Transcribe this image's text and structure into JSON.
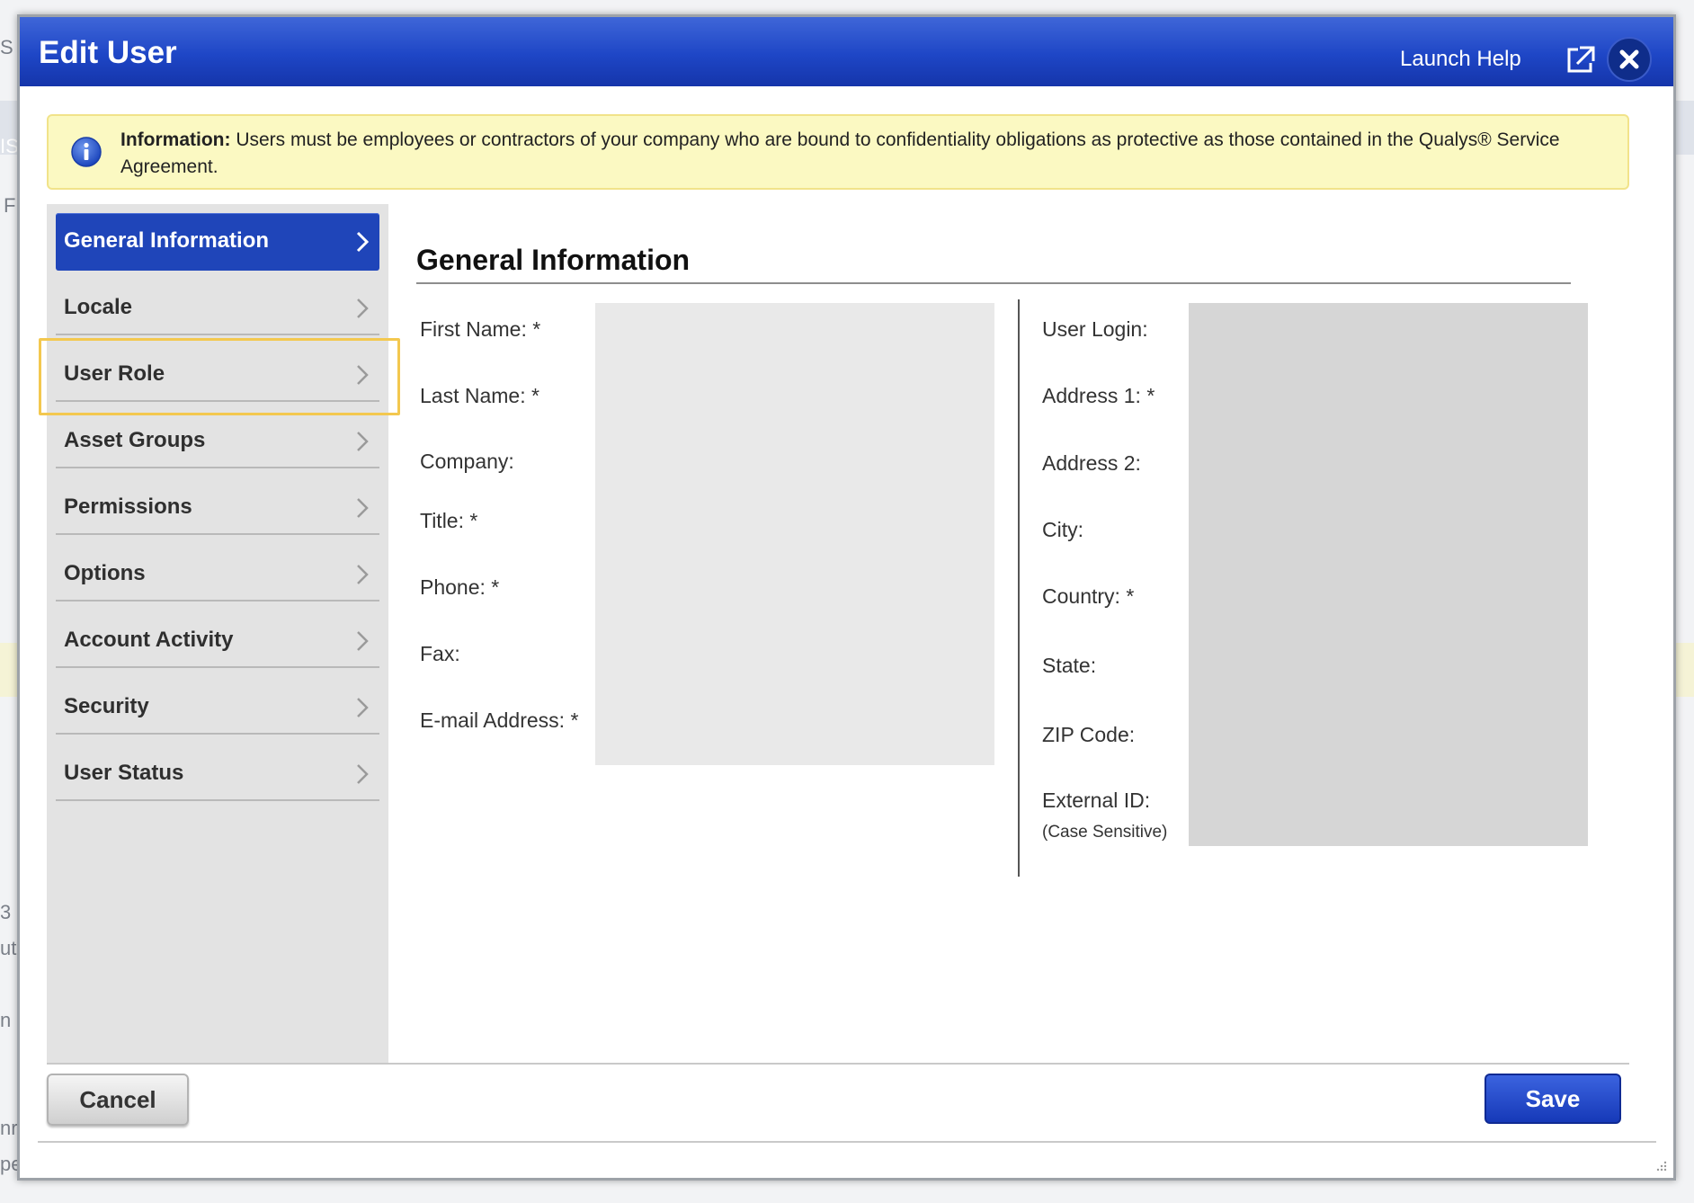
{
  "background": {
    "fragments": [
      "S",
      "IS",
      "F",
      "3",
      "ut",
      "n",
      "nr",
      "pe"
    ]
  },
  "dialog": {
    "title": "Edit User",
    "launch_help": "Launch Help",
    "popout_icon": "external-link-icon",
    "close_icon": "close-icon",
    "accent_color": "#1e46c6"
  },
  "info": {
    "icon": "info-icon",
    "heading": "Information:",
    "text": "Users must be employees or contractors of your company who are bound to confidentiality obligations as protective as those contained in the Qualys® Service Agreement."
  },
  "sidebar": {
    "items": [
      {
        "label": "General Information",
        "active": true
      },
      {
        "label": "Locale",
        "active": false
      },
      {
        "label": "User Role",
        "active": false
      },
      {
        "label": "Asset Groups",
        "active": false
      },
      {
        "label": "Permissions",
        "active": false
      },
      {
        "label": "Options",
        "active": false
      },
      {
        "label": "Account Activity",
        "active": false
      },
      {
        "label": "Security",
        "active": false
      },
      {
        "label": "User Status",
        "active": false
      }
    ]
  },
  "main": {
    "section_title": "General Information",
    "left_fields": [
      "First Name: *",
      "Last Name: *",
      "Company:",
      "Title: *",
      "Phone: *",
      "Fax:",
      "E-mail Address: *"
    ],
    "right_fields": [
      "User Login:",
      "Address 1: *",
      "Address 2:",
      "City:",
      "Country: *",
      "State:",
      "ZIP Code:",
      "External ID:"
    ],
    "external_id_note": "(Case Sensitive)"
  },
  "footer": {
    "cancel_label": "Cancel",
    "save_label": "Save"
  }
}
